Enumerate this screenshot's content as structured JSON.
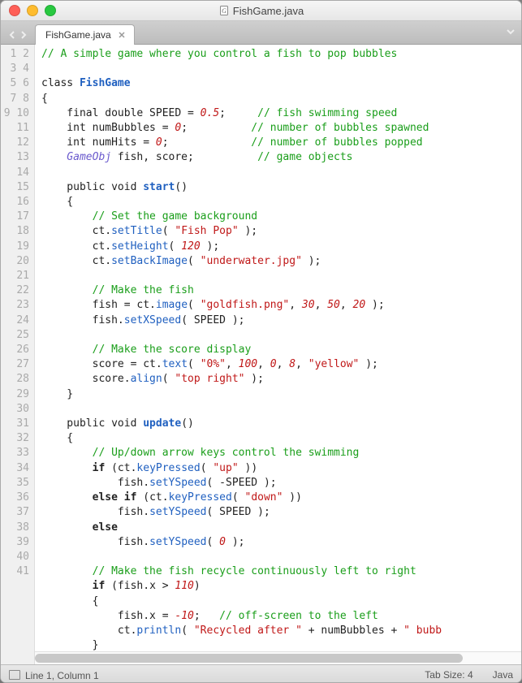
{
  "window": {
    "title": "FishGame.java"
  },
  "tab": {
    "label": "FishGame.java"
  },
  "status": {
    "cursor": "Line 1, Column 1",
    "tabsize": "Tab Size: 4",
    "language": "Java"
  },
  "code": {
    "l1_c": "// A simple game where you control a fish to pop bubbles",
    "l3_kw": "class",
    "l3_cn": "FishGame",
    "l4": "{",
    "l5_a": "    final double SPEED = ",
    "l5_n": "0.5",
    "l5_b": ";     ",
    "l5_c": "// fish swimming speed",
    "l6_a": "    int numBubbles = ",
    "l6_n": "0",
    "l6_b": ";          ",
    "l6_c": "// number of bubbles spawned",
    "l7_a": "    int numHits = ",
    "l7_n": "0",
    "l7_b": ";             ",
    "l7_c": "// number of bubbles popped",
    "l8_t": "    GameObj",
    "l8_a": " fish, score;          ",
    "l8_c": "// game objects",
    "l10_a": "    public void ",
    "l10_f": "start",
    "l10_b": "()",
    "l11": "    {",
    "l12_c": "        // Set the game background",
    "l13_a": "        ct.",
    "l13_f": "setTitle",
    "l13_b": "( ",
    "l13_s": "\"Fish Pop\"",
    "l13_e": " );",
    "l14_a": "        ct.",
    "l14_f": "setHeight",
    "l14_b": "( ",
    "l14_n": "120",
    "l14_e": " );",
    "l15_a": "        ct.",
    "l15_f": "setBackImage",
    "l15_b": "( ",
    "l15_s": "\"underwater.jpg\"",
    "l15_e": " );",
    "l17_c": "        // Make the fish",
    "l18_a": "        fish = ct.",
    "l18_f": "image",
    "l18_b": "( ",
    "l18_s": "\"goldfish.png\"",
    "l18_c2": ", ",
    "l18_n1": "30",
    "l18_c3": ", ",
    "l18_n2": "50",
    "l18_c4": ", ",
    "l18_n3": "20",
    "l18_e": " );",
    "l19_a": "        fish.",
    "l19_f": "setXSpeed",
    "l19_b": "( SPEED );",
    "l21_c": "        // Make the score display",
    "l22_a": "        score = ct.",
    "l22_f": "text",
    "l22_b": "( ",
    "l22_s1": "\"0%\"",
    "l22_c2": ", ",
    "l22_n1": "100",
    "l22_c3": ", ",
    "l22_n2": "0",
    "l22_c4": ", ",
    "l22_n3": "8",
    "l22_c5": ", ",
    "l22_s2": "\"yellow\"",
    "l22_e": " );",
    "l23_a": "        score.",
    "l23_f": "align",
    "l23_b": "( ",
    "l23_s": "\"top right\"",
    "l23_e": " );",
    "l24": "    }",
    "l26_a": "    public void ",
    "l26_f": "update",
    "l26_b": "()",
    "l27": "    {",
    "l28_c": "        // Up/down arrow keys control the swimming",
    "l29_a": "        ",
    "l29_k": "if",
    "l29_b": " (ct.",
    "l29_f": "keyPressed",
    "l29_c2": "( ",
    "l29_s": "\"up\"",
    "l29_e": " ))",
    "l30_a": "            fish.",
    "l30_f": "setYSpeed",
    "l30_b": "( -SPEED );",
    "l31_a": "        ",
    "l31_k": "else if",
    "l31_b": " (ct.",
    "l31_f": "keyPressed",
    "l31_c2": "( ",
    "l31_s": "\"down\"",
    "l31_e": " ))",
    "l32_a": "            fish.",
    "l32_f": "setYSpeed",
    "l32_b": "( SPEED );",
    "l33_a": "        ",
    "l33_k": "else",
    "l34_a": "            fish.",
    "l34_f": "setYSpeed",
    "l34_b": "( ",
    "l34_n": "0",
    "l34_e": " );",
    "l36_c": "        // Make the fish recycle continuously left to right",
    "l37_a": "        ",
    "l37_k": "if",
    "l37_b": " (fish.x > ",
    "l37_n": "110",
    "l37_e": ")",
    "l38": "        {",
    "l39_a": "            fish.x = ",
    "l39_n": "-10",
    "l39_b": ";   ",
    "l39_c": "// off-screen to the left",
    "l40_a": "            ct.",
    "l40_f": "println",
    "l40_b": "( ",
    "l40_s1": "\"Recycled after \"",
    "l40_c2": " + numBubbles + ",
    "l40_s2": "\" bubb",
    "l41": "        }"
  }
}
